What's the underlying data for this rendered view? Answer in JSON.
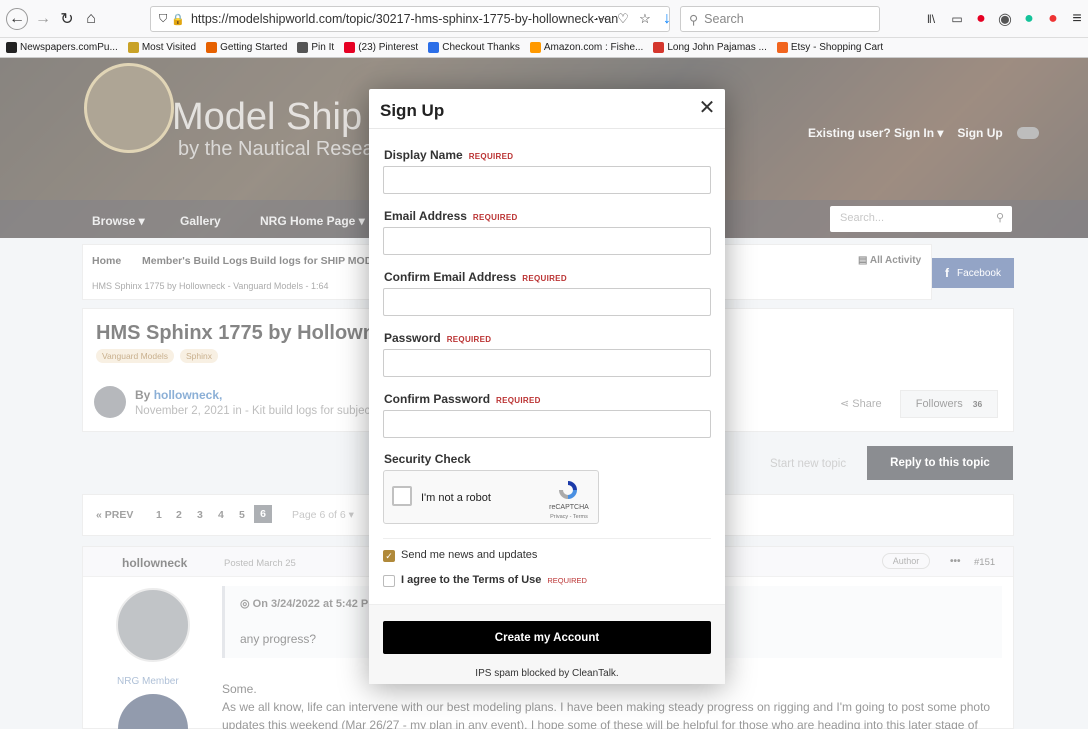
{
  "browser": {
    "url": "https://modelshipworld.com/topic/30217-hms-sphinx-1775-by-hollowneck-van",
    "search_placeholder": "Search",
    "bookmarks": [
      {
        "label": "Newspapers.comPu...",
        "color": "#222222"
      },
      {
        "label": "Most Visited",
        "color": "#c9a227"
      },
      {
        "label": "Getting Started",
        "color": "#e66000"
      },
      {
        "label": "Pin It",
        "color": "#555555"
      },
      {
        "label": "(23) Pinterest",
        "color": "#e60023"
      },
      {
        "label": "Checkout Thanks",
        "color": "#2b6ee8"
      },
      {
        "label": "Amazon.com : Fishe...",
        "color": "#ff9900"
      },
      {
        "label": "Long John Pajamas ...",
        "color": "#d4362d"
      },
      {
        "label": "Etsy - Shopping Cart",
        "color": "#f1641e"
      }
    ]
  },
  "site": {
    "title": "Model Ship W",
    "subtitle": "by the Nautical Research",
    "existing_user": "Existing user? Sign In ▾",
    "sign_up": "Sign Up",
    "nav": [
      "Browse ▾",
      "Gallery",
      "NRG Home Page ▾"
    ],
    "search_placeholder": "Search..."
  },
  "breadcrumb": {
    "items": [
      "Home",
      "Member's Build Logs",
      "Build logs for SHIP MODEL KI"
    ],
    "sub": "HMS Sphinx 1775 by Hollowneck - Vanguard Models - 1:64",
    "all_activity": "All Activity",
    "facebook": "Facebook"
  },
  "topic": {
    "title": "HMS Sphinx 1775 by Hollowneck",
    "tags": [
      "Vanguard Models",
      "Sphinx"
    ],
    "by_prefix": "By",
    "author": "hollowneck,",
    "date_line": "November 2, 2021 in - Kit build logs for subjects",
    "share": "Share",
    "followers_label": "Followers",
    "followers_count": "36",
    "start_new_topic": "Start new topic",
    "reply": "Reply to this topic"
  },
  "pagination": {
    "prev": "« PREV",
    "pages": [
      "1",
      "2",
      "3",
      "4",
      "5"
    ],
    "current": "6",
    "page_of": "Page 6 of 6 ▾"
  },
  "post": {
    "author": "hollowneck",
    "date": "Posted March 25",
    "badge": "Author",
    "number": "#151",
    "member_label": "NRG Member",
    "quote_head": "On 3/24/2022 at 5:42 PM",
    "quote_body": "any progress?",
    "line1": "Some.",
    "line2": "As we all know, life can intervene with our best modeling plans. I have been making steady progress on rigging and I'm going to post some photo updates this weekend (Mar 26/27 - my plan in any event). I hope some of these will be helpful for those who are heading into this later stage of"
  },
  "modal": {
    "title": "Sign Up",
    "required": "REQUIRED",
    "fields": [
      {
        "label": "Display Name",
        "value": ""
      },
      {
        "label": "Email Address",
        "value": ""
      },
      {
        "label": "Confirm Email Address",
        "value": ""
      },
      {
        "label": "Password",
        "value": ""
      },
      {
        "label": "Confirm Password",
        "value": ""
      }
    ],
    "security_check": "Security Check",
    "captcha_text": "I'm not a robot",
    "captcha_brand": "reCAPTCHA",
    "captcha_terms": "Privacy - Terms",
    "news_label": "Send me news and updates",
    "terms_label": "I agree to the Terms of Use",
    "create_button": "Create my Account",
    "spam_note": "IPS spam blocked by CleanTalk."
  },
  "colors": {
    "accent_gold": "#b0893a",
    "required_red": "#bb3333",
    "facebook": "#3b5998"
  }
}
